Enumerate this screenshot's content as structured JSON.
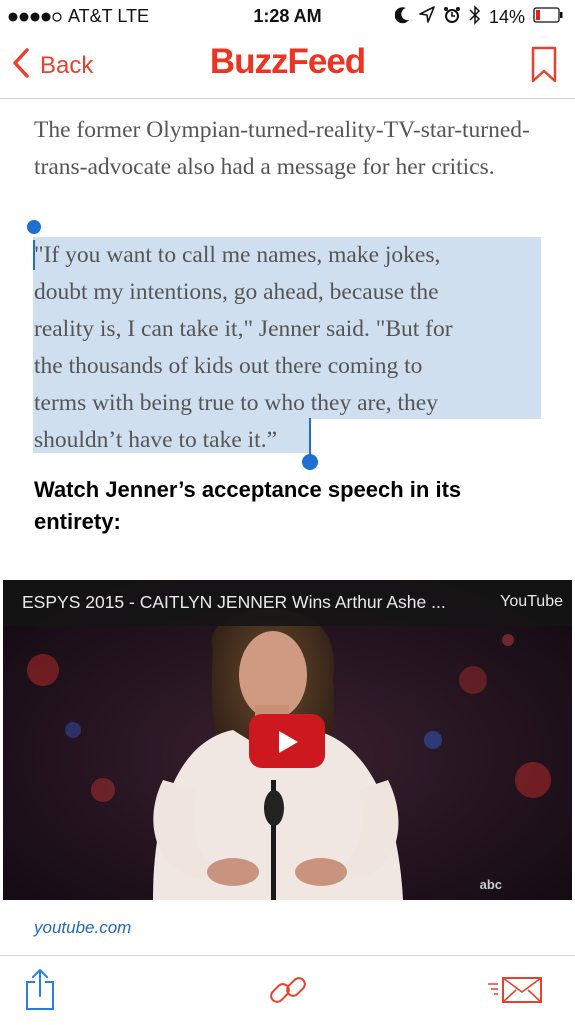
{
  "status": {
    "carrier": "AT&T  LTE",
    "time": "1:28 AM",
    "battery": "14%"
  },
  "nav": {
    "back_label": "Back",
    "logo_text": "BuzzFeed",
    "accent": "#e8412c"
  },
  "article": {
    "paragraph": "The former Olympian-turned-reality-TV-star-turned-trans-advocate also had a message for her critics.",
    "quote_lines": [
      "\"If you want to call me names, make jokes,",
      "doubt my intentions, go ahead, because the",
      "reality is, I can take it,\" Jenner said. \"But for",
      "the thousands of kids out there coming to",
      "terms with being true to who they are, they",
      "shouldn’t have to take it.”"
    ],
    "heading": "Watch Jenner’s acceptance speech in its entirety:"
  },
  "video": {
    "title": "ESPYS 2015 - CAITLYN JENNER Wins Arthur Ashe ...",
    "provider": "YouTube",
    "watermark": "abc",
    "source": "youtube.com"
  },
  "toolbar": {
    "icons": [
      "share-icon",
      "link-icon",
      "mail-icon"
    ]
  }
}
